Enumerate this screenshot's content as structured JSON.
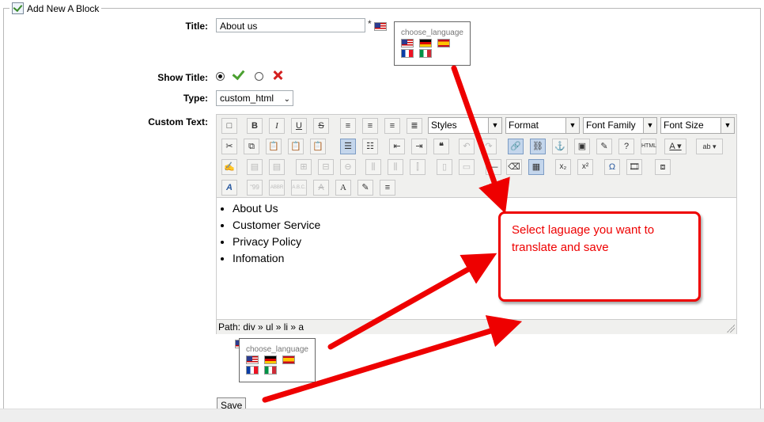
{
  "legend": {
    "title": "Add New A Block"
  },
  "form": {
    "title_label": "Title:",
    "title_value": "About us",
    "required_mark": "*",
    "show_title_label": "Show Title:",
    "type_label": "Type:",
    "type_value": "custom_html",
    "custom_text_label": "Custom Text:"
  },
  "language_picker": {
    "title": "choose_language",
    "flags_row1": [
      "us-flag",
      "de-flag",
      "es-flag"
    ],
    "flags_row2": [
      "fr-flag",
      "it-flag"
    ]
  },
  "editor": {
    "styles_label": "Styles",
    "format_label": "Format",
    "font_family_label": "Font Family",
    "font_size_label": "Font Size",
    "content_items": [
      "About Us",
      "Customer Service",
      "Privacy Policy",
      "Infomation"
    ],
    "path_text": "Path: div » ul » li » a"
  },
  "callout": {
    "text": "Select laguage you want to translate and save",
    "color": "#e00000"
  },
  "buttons": {
    "save_label": "Save"
  }
}
